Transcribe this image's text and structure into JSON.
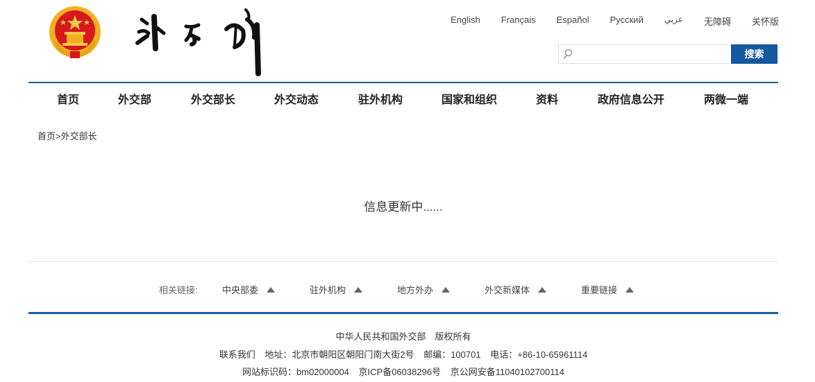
{
  "header": {
    "languages": [
      "English",
      "Français",
      "Español",
      "Русский",
      "عربي",
      "无障碍",
      "关怀版"
    ],
    "search": {
      "placeholder": "",
      "button": "搜索"
    }
  },
  "nav": [
    "首页",
    "外交部",
    "外交部长",
    "外交动态",
    "驻外机构",
    "国家和组织",
    "资料",
    "政府信息公开",
    "两微一端"
  ],
  "breadcrumb": {
    "home": "首页",
    "sep": ">",
    "current": "外交部长"
  },
  "notice": "信息更新中......",
  "related": {
    "label": "相关链接:",
    "links": [
      "中央部委",
      "驻外机构",
      "地方外办",
      "外交新媒体",
      "重要链接"
    ]
  },
  "footer": {
    "copyright": "中华人民共和国外交部　版权所有",
    "contact": [
      "联系我们",
      "地址：北京市朝阳区朝阳门南大街2号",
      "邮编：100701",
      "电话：+86-10-65961114"
    ],
    "records": [
      "网站标识码：bm02000004",
      "京ICP备06038296号",
      "京公网安备11040102700114"
    ]
  },
  "colors": {
    "primary": "#14589e",
    "rule": "#1c5c9c",
    "emblem_red": "#d7181d",
    "emblem_gold": "#f2b01e"
  },
  "icons": {
    "emblem": "national-emblem-icon",
    "search": "search-icon",
    "expand": "triangle-up-icon"
  }
}
